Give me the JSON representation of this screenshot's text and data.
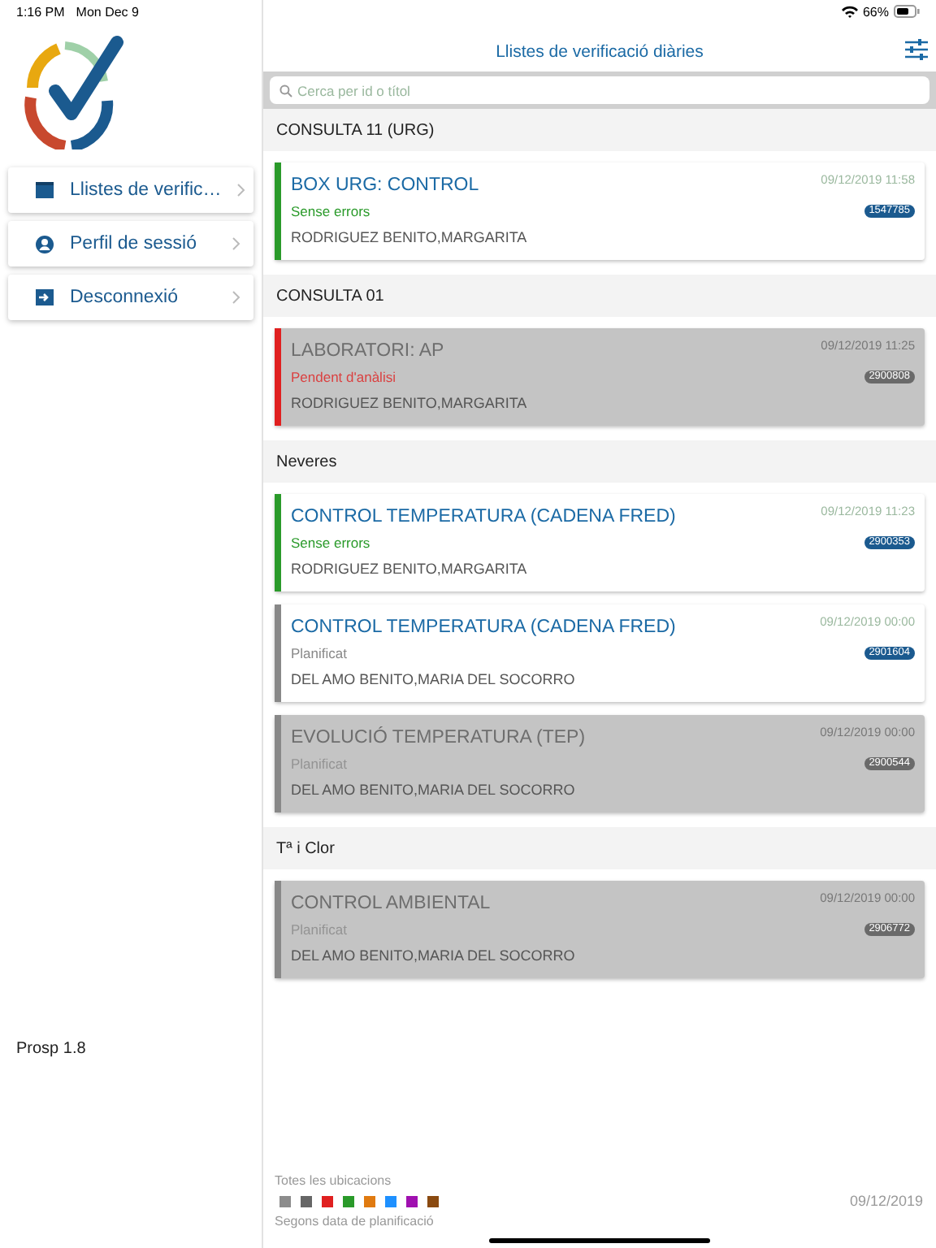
{
  "status_bar": {
    "time": "1:16 PM",
    "date": "Mon Dec 9",
    "battery": "66%"
  },
  "sidebar": {
    "items": [
      {
        "kind": "calendar",
        "label": "Llistes de verific…"
      },
      {
        "kind": "profile",
        "label": "Perfil de sessió"
      },
      {
        "kind": "logout",
        "label": "Desconnexió"
      }
    ],
    "version": "Prosp 1.8"
  },
  "header": {
    "title": "Llistes de verificació diàries"
  },
  "search": {
    "placeholder": "Cerca per id o títol"
  },
  "groups": [
    {
      "name": "CONSULTA 11 (URG)",
      "cards": [
        {
          "title": "BOX URG: CONTROL",
          "color": "#2a9a2a",
          "status_text": "Sense errors",
          "date": "09/12/2019 11:58",
          "id": "1547785",
          "person": "RODRIGUEZ BENITO,MARGARITA",
          "disabled": false
        }
      ]
    },
    {
      "name": "CONSULTA 01",
      "cards": [
        {
          "title": "LABORATORI: AP",
          "color": "#e02020",
          "status_text": "Pendent d'anàlisi",
          "date": "09/12/2019 11:25",
          "id": "2900808",
          "person": "RODRIGUEZ BENITO,MARGARITA",
          "disabled": true
        }
      ]
    },
    {
      "name": "Neveres",
      "cards": [
        {
          "title": "CONTROL TEMPERATURA (CADENA FRED)",
          "color": "#2a9a2a",
          "status_text": "Sense errors",
          "date": "09/12/2019 11:23",
          "id": "2900353",
          "person": "RODRIGUEZ BENITO,MARGARITA",
          "disabled": false
        },
        {
          "title": "CONTROL TEMPERATURA (CADENA FRED)",
          "color": "#888888",
          "status_text": "Planificat",
          "date": "09/12/2019 00:00",
          "id": "2901604",
          "person": "DEL AMO BENITO,MARIA DEL SOCORRO",
          "disabled": false
        },
        {
          "title": "EVOLUCIÓ TEMPERATURA (TEP)",
          "color": "#888888",
          "status_text": "Planificat",
          "date": "09/12/2019 00:00",
          "id": "2900544",
          "person": "DEL AMO BENITO,MARIA DEL SOCORRO",
          "disabled": true
        }
      ]
    },
    {
      "name": "Tª i Clor",
      "cards": [
        {
          "title": "CONTROL AMBIENTAL",
          "color": "#888888",
          "status_text": "Planificat",
          "date": "09/12/2019 00:00",
          "id": "2906772",
          "person": "DEL AMO BENITO,MARIA DEL SOCORRO",
          "disabled": true
        }
      ]
    }
  ],
  "footer": {
    "filter": "Totes les ubicacions",
    "colors": [
      {
        "color": "#8c8c8c"
      },
      {
        "color": "#666666"
      },
      {
        "color": "#e02020"
      },
      {
        "color": "#2a9a2a"
      },
      {
        "color": "#e07a10"
      },
      {
        "color": "#1e90ff"
      },
      {
        "color": "#a010b0"
      },
      {
        "color": "#8a4a10"
      }
    ],
    "sort": "Segons data de planificació",
    "date": "09/12/2019"
  }
}
